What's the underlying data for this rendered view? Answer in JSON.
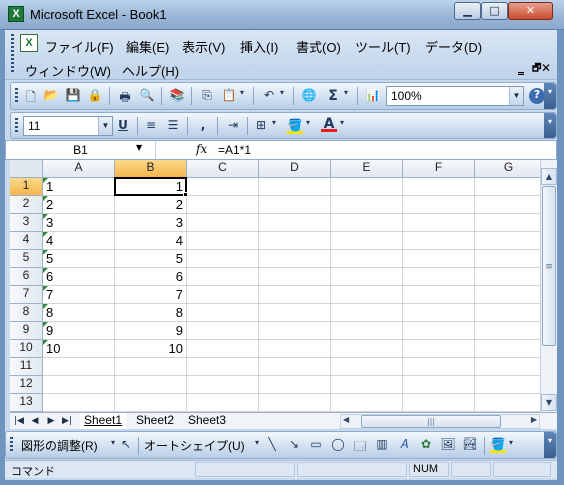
{
  "window": {
    "title": "Microsoft Excel - Book1",
    "app_icon": "X",
    "buttons": {
      "minimize": "▁",
      "maximize": "□",
      "close": "✕"
    }
  },
  "menubar": {
    "items": [
      {
        "label": "ファイル(F)"
      },
      {
        "label": "編集(E)"
      },
      {
        "label": "表示(V)"
      },
      {
        "label": "挿入(I)"
      },
      {
        "label": "書式(O)"
      },
      {
        "label": "ツール(T)"
      },
      {
        "label": "データ(D)"
      },
      {
        "label": "ウィンドウ(W)"
      },
      {
        "label": "ヘルプ(H)"
      }
    ],
    "mdi": {
      "minimize": "‗",
      "restore": "🗗",
      "close": "✕"
    }
  },
  "standard_toolbar": {
    "zoom": "100%",
    "sum": "Σ",
    "icons": [
      "new-icon",
      "open-icon",
      "save-icon",
      "permission-icon",
      "print-icon",
      "print-preview-icon",
      "research-icon",
      "copy-icon",
      "paste-icon",
      "undo-icon",
      "hyperlink-icon",
      "autosum-icon",
      "chart-wizard-icon",
      "help-icon"
    ]
  },
  "formatting_toolbar": {
    "font_size": "11",
    "underline": "U",
    "comma": ",",
    "font_color_letter": "A"
  },
  "formula_bar": {
    "name_box": "B1",
    "fx": "fx",
    "formula": "=A1*1"
  },
  "grid": {
    "columns": [
      "A",
      "B",
      "C",
      "D",
      "E",
      "F",
      "G"
    ],
    "selected_column": "B",
    "selected_row": 1,
    "rows": [
      {
        "n": "1",
        "a": "1",
        "b": "1"
      },
      {
        "n": "2",
        "a": "2",
        "b": "2"
      },
      {
        "n": "3",
        "a": "3",
        "b": "3"
      },
      {
        "n": "4",
        "a": "4",
        "b": "4"
      },
      {
        "n": "5",
        "a": "5",
        "b": "5"
      },
      {
        "n": "6",
        "a": "6",
        "b": "6"
      },
      {
        "n": "7",
        "a": "7",
        "b": "7"
      },
      {
        "n": "8",
        "a": "8",
        "b": "8"
      },
      {
        "n": "9",
        "a": "9",
        "b": "9"
      },
      {
        "n": "10",
        "a": "10",
        "b": "10"
      },
      {
        "n": "11",
        "a": "",
        "b": ""
      },
      {
        "n": "12",
        "a": "",
        "b": ""
      },
      {
        "n": "13",
        "a": "",
        "b": ""
      }
    ]
  },
  "sheet_tabs": {
    "tabs": [
      "Sheet1",
      "Sheet2",
      "Sheet3"
    ],
    "active": "Sheet1"
  },
  "drawing_toolbar": {
    "draw_menu": "図形の調整(R)",
    "autoshapes": "オートシェイプ(U)"
  },
  "status_bar": {
    "mode": "コマンド",
    "num": "NUM"
  },
  "colors": {
    "selection_header": "#f5b54b",
    "text_number_marker": "#2f8a3b"
  }
}
